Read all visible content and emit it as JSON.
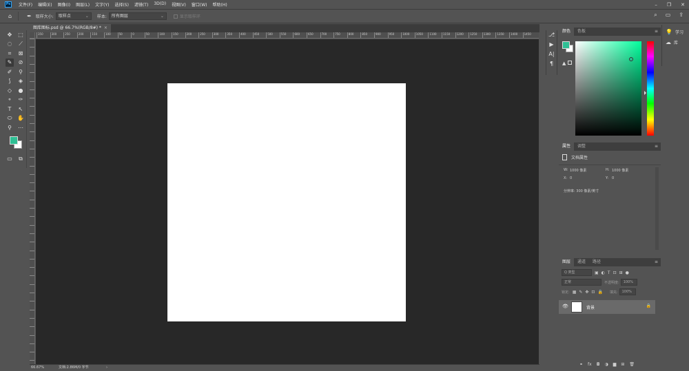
{
  "app": {
    "logo": "Ps"
  },
  "menu": [
    "文件(F)",
    "编辑(E)",
    "图像(I)",
    "图层(L)",
    "文字(Y)",
    "选择(S)",
    "滤镜(T)",
    "3D(D)",
    "视图(V)",
    "窗口(W)",
    "帮助(H)"
  ],
  "window_controls": {
    "minimize": "–",
    "restore": "❐",
    "close": "✕"
  },
  "options": {
    "home_icon": "⌂",
    "tool_icon": "✒",
    "sample_size_label": "取样大小:",
    "sample_size_value": "取样点",
    "sample_label": "样本:",
    "sample_value": "所有图层",
    "show_ring_label": "显示取样环",
    "search_icon": "⌕",
    "workspace_icon": "▭",
    "share_icon": "⇪"
  },
  "document": {
    "tab_title": "图库图标.psd @ 66.7%(RGB/8#) *",
    "tab_close": "×",
    "background": "#ffffff"
  },
  "rulers": {
    "h_labels": [
      "350",
      "300",
      "250",
      "200",
      "150",
      "100",
      "50",
      "0",
      "50",
      "100",
      "150",
      "200",
      "250",
      "300",
      "350",
      "400",
      "450",
      "500",
      "550",
      "600",
      "650",
      "700",
      "750",
      "800",
      "850",
      "900",
      "950",
      "1000",
      "1050",
      "1100",
      "1150",
      "1200",
      "1250",
      "1300",
      "1350",
      "1400",
      "1450"
    ]
  },
  "status": {
    "zoom": "66.67%",
    "doc_info": "文档:2.86M/0 字节",
    "arrow": "›"
  },
  "toolbar": {
    "tools": [
      [
        "✥",
        "⬚"
      ],
      [
        "◌",
        "⟋"
      ],
      [
        "⌗",
        "⊠"
      ],
      [
        "✎",
        "⊘"
      ],
      [
        "✐",
        "⚲"
      ],
      [
        "⟆",
        "◈"
      ],
      [
        "◇",
        "●"
      ],
      [
        "⚬",
        "✑"
      ],
      [
        "T",
        "↖"
      ],
      [
        "⬭",
        "✋"
      ],
      [
        "⚲",
        "⋯"
      ]
    ],
    "bottom": [
      "▭",
      "⧉"
    ],
    "foreground": "#2fbf94",
    "background": "#ffffff"
  },
  "mid_strip": [
    "⎇",
    "▶",
    "A|",
    "¶"
  ],
  "color_panel": {
    "tabs": [
      "颜色",
      "色板"
    ],
    "menu": "≡",
    "hue_color": "#00ff9c",
    "pointer_color": "#2fbf94",
    "pointer": {
      "s": 0.84,
      "v": 0.81
    },
    "hue_level": 0.55,
    "warn_icon": "▲"
  },
  "properties": {
    "tabs": [
      "属性",
      "调整"
    ],
    "menu": "≡",
    "title": "文档属性",
    "w_label": "W:",
    "w_value": "1000 像素",
    "h_label": "H:",
    "h_value": "1000 像素",
    "x_label": "X:",
    "x_value": "0",
    "y_label": "Y:",
    "y_value": "0",
    "resolution": "分辨率: 300 像素/英寸"
  },
  "layers": {
    "tabs": [
      "图层",
      "通道",
      "路径"
    ],
    "menu": "≡",
    "filter_placeholder": "Q 类型",
    "filter_icons": [
      "▣",
      "◐",
      "T",
      "⊡",
      "⊞",
      "●"
    ],
    "blend_mode": "正常",
    "opacity_label": "不透明度:",
    "opacity_value": "100%",
    "lock_label": "锁定:",
    "lock_icons": [
      "▦",
      "✎",
      "✥",
      "⊡",
      "🔒"
    ],
    "fill_label": "填充:",
    "fill_value": "100%",
    "layer_eye": "👁",
    "layer_name": "背景",
    "layer_lock": "🔒",
    "bottom_icons": [
      "⚭",
      "fx",
      "◘",
      "◑",
      "▆",
      "⊞",
      "🗑"
    ]
  },
  "far_right": [
    {
      "icon": "💡",
      "label": "学习"
    },
    {
      "icon": "☁",
      "label": "库"
    }
  ]
}
